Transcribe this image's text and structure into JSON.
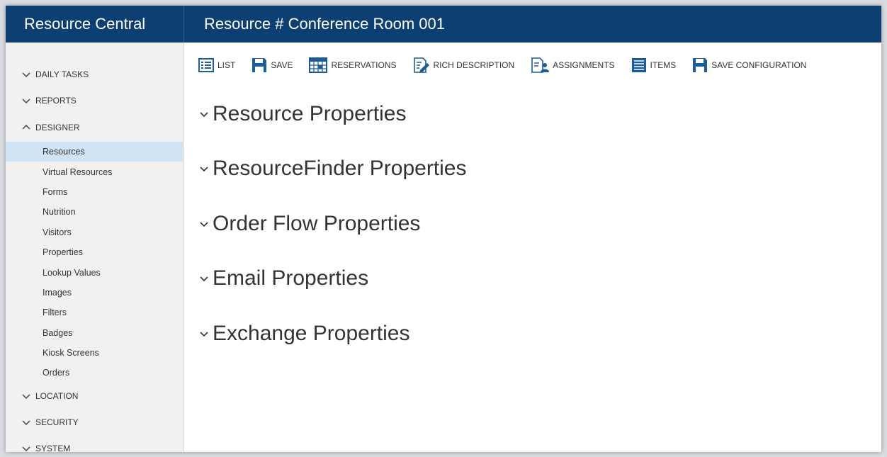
{
  "app": {
    "title": "Resource Central"
  },
  "header": {
    "title": "Resource # Conference Room 001"
  },
  "colors": {
    "header_bg": "#0d3f73",
    "sidebar_bg": "#f1f1f1",
    "active_item_bg": "#cfe4f5",
    "icon_blue": "#1b5d9a"
  },
  "sidebar": {
    "sections": [
      {
        "label": "DAILY TASKS",
        "expanded": false,
        "icon": "chevron-down-icon"
      },
      {
        "label": "REPORTS",
        "expanded": false,
        "icon": "chevron-down-icon"
      },
      {
        "label": "DESIGNER",
        "expanded": true,
        "icon": "chevron-up-icon"
      },
      {
        "label": "LOCATION",
        "expanded": false,
        "icon": "chevron-down-icon"
      },
      {
        "label": "SECURITY",
        "expanded": false,
        "icon": "chevron-down-icon"
      },
      {
        "label": "SYSTEM",
        "expanded": false,
        "icon": "chevron-down-icon"
      }
    ],
    "designer_items": [
      {
        "label": "Resources",
        "active": true
      },
      {
        "label": "Virtual Resources",
        "active": false
      },
      {
        "label": "Forms",
        "active": false
      },
      {
        "label": "Nutrition",
        "active": false
      },
      {
        "label": "Visitors",
        "active": false
      },
      {
        "label": "Properties",
        "active": false
      },
      {
        "label": "Lookup Values",
        "active": false
      },
      {
        "label": "Images",
        "active": false
      },
      {
        "label": "Filters",
        "active": false
      },
      {
        "label": "Badges",
        "active": false
      },
      {
        "label": "Kiosk Screens",
        "active": false
      },
      {
        "label": "Orders",
        "active": false
      }
    ]
  },
  "toolbar": {
    "buttons": [
      {
        "label": "LIST",
        "icon": "list-icon"
      },
      {
        "label": "SAVE",
        "icon": "floppy-disk-icon"
      },
      {
        "label": "RESERVATIONS",
        "icon": "calendar-grid-icon"
      },
      {
        "label": "RICH DESCRIPTION",
        "icon": "edit-document-icon"
      },
      {
        "label": "ASSIGNMENTS",
        "icon": "assignment-icon"
      },
      {
        "label": "ITEMS",
        "icon": "items-list-icon"
      },
      {
        "label": "SAVE CONFIGURATION",
        "icon": "floppy-disk-icon"
      }
    ]
  },
  "panels": [
    {
      "label": "Resource Properties"
    },
    {
      "label": "ResourceFinder Properties"
    },
    {
      "label": "Order Flow Properties"
    },
    {
      "label": "Email Properties"
    },
    {
      "label": "Exchange Properties"
    }
  ]
}
